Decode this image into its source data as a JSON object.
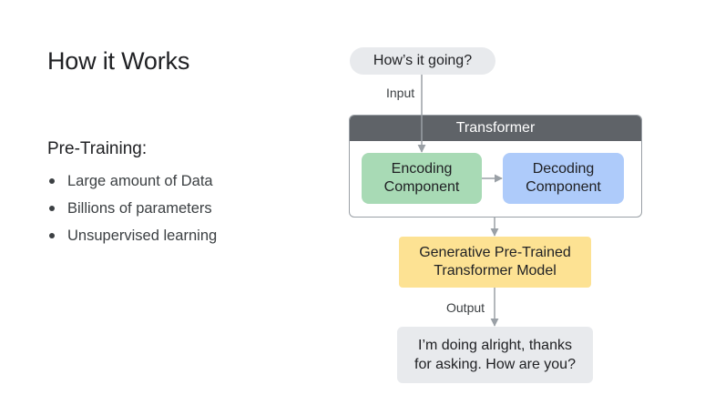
{
  "slide": {
    "title": "How it Works",
    "section_heading": "Pre-Training:",
    "bullets": [
      "Large amount of Data",
      "Billions of parameters",
      "Unsupervised learning"
    ]
  },
  "diagram": {
    "input_prompt": "How’s it going?",
    "input_label": "Input",
    "transformer_label": "Transformer",
    "encoding": {
      "line1": "Encoding",
      "line2": "Component"
    },
    "decoding": {
      "line1": "Decoding",
      "line2": "Component"
    },
    "model": {
      "line1": "Generative Pre-Trained",
      "line2": "Transformer Model"
    },
    "output_label": "Output",
    "response": {
      "line1": "I’m doing alright, thanks",
      "line2": "for asking. How are you?"
    }
  },
  "colors": {
    "transformer_header": "#5f6368",
    "encoding_fill": "#a8dab5",
    "decoding_fill": "#aecbfa",
    "model_fill": "#fde293",
    "bubble_fill": "#e8eaed",
    "arrow": "#9aa0a6"
  }
}
